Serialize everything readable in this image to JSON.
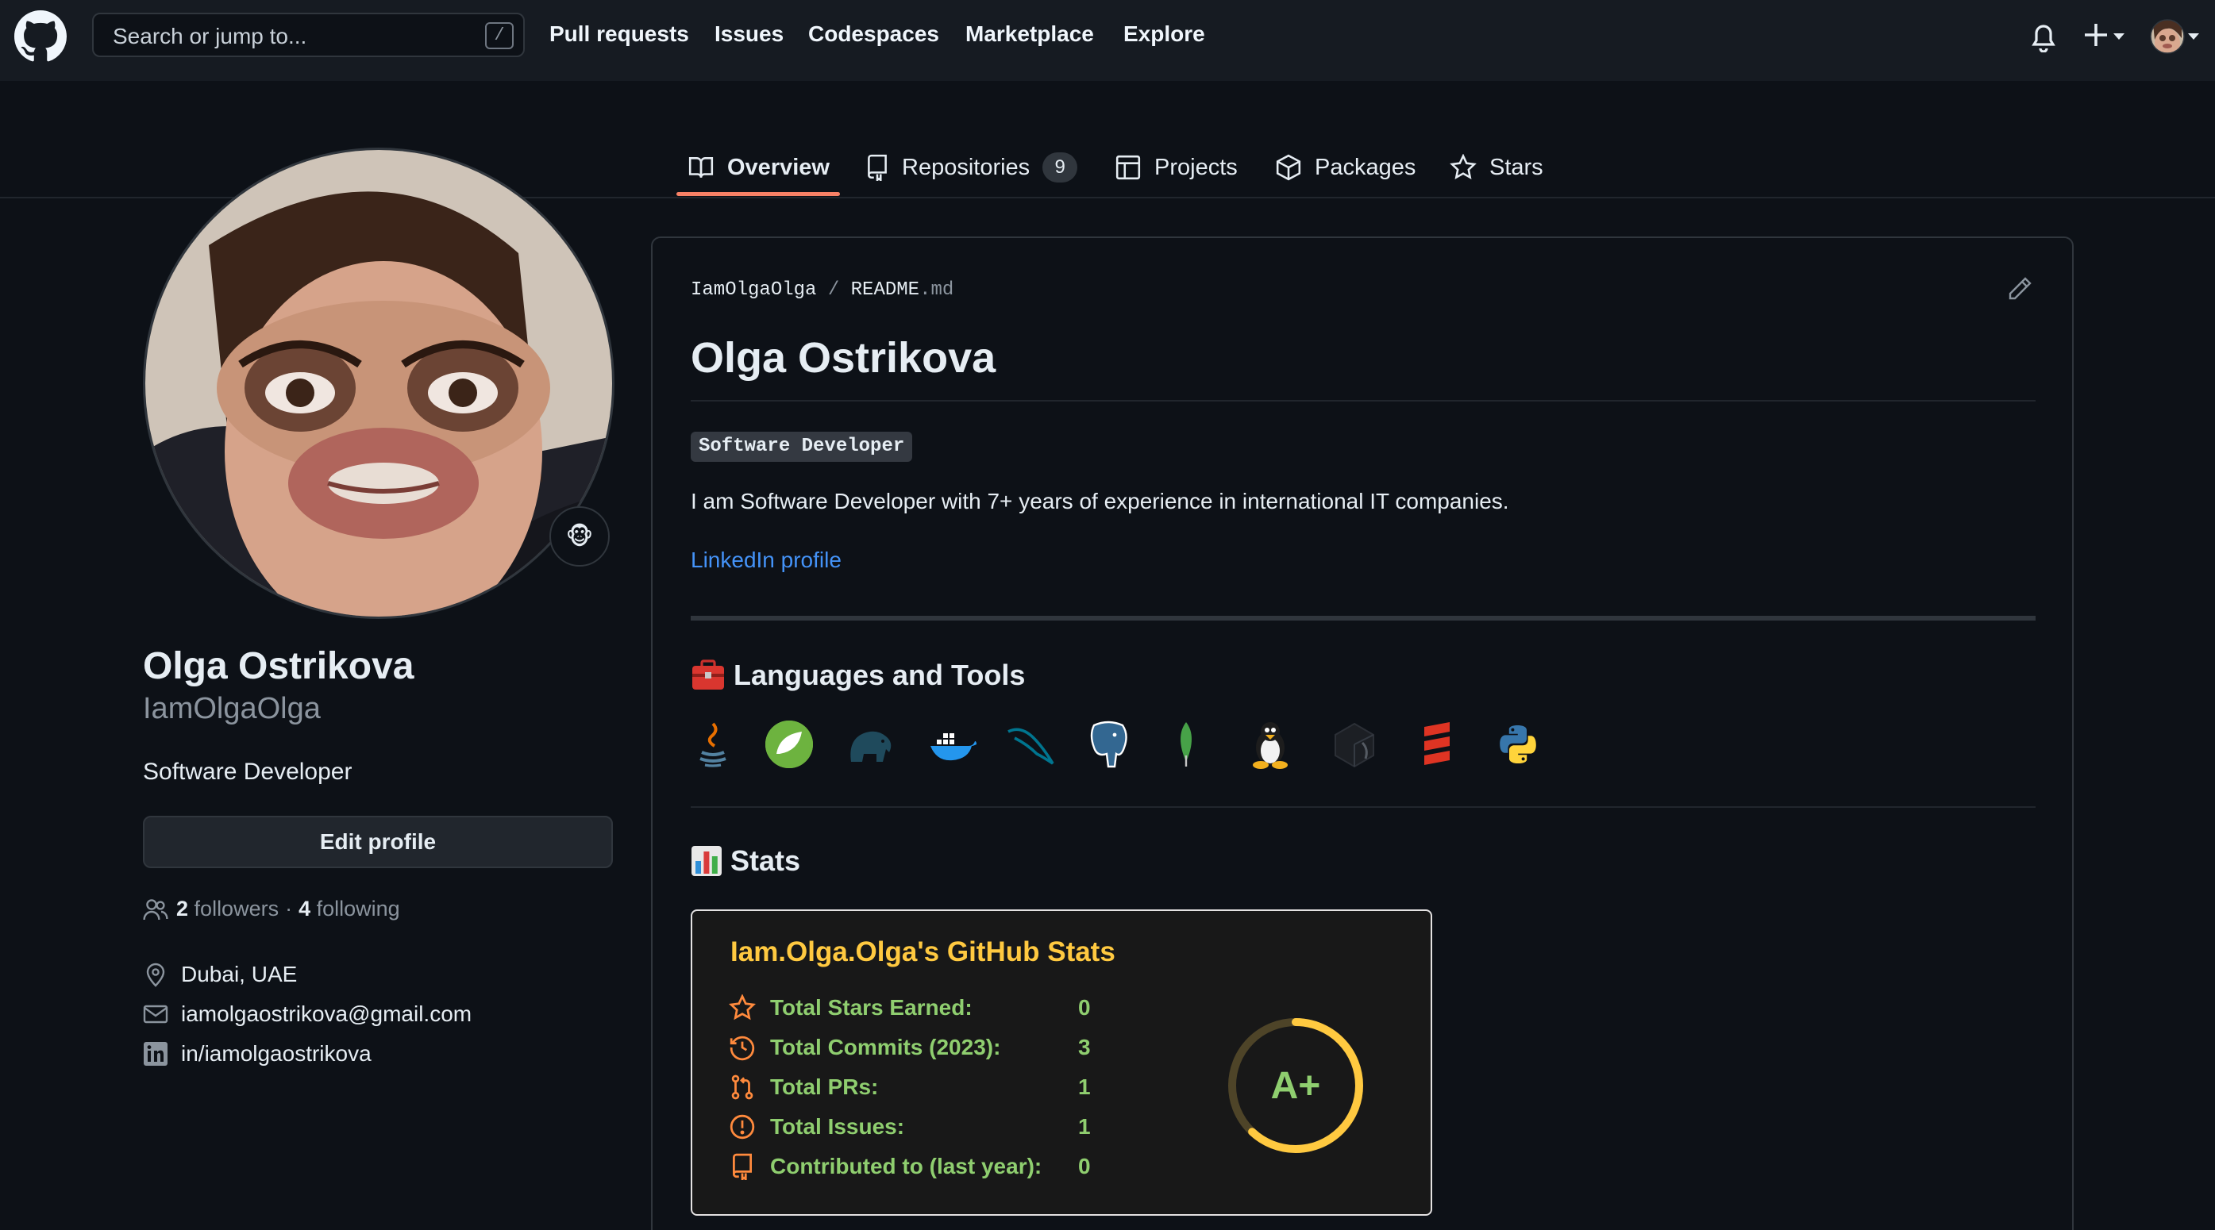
{
  "header": {
    "search_placeholder": "Search or jump to...",
    "search_shortcut": "/",
    "nav": [
      "Pull requests",
      "Issues",
      "Codespaces",
      "Marketplace",
      "Explore"
    ],
    "icons": [
      "github-logo",
      "bell-icon",
      "plus-icon",
      "avatar-menu"
    ]
  },
  "tabs": [
    {
      "label": "Overview",
      "icon": "book-icon",
      "active": true
    },
    {
      "label": "Repositories",
      "icon": "repo-icon",
      "count": "9"
    },
    {
      "label": "Projects",
      "icon": "table-icon"
    },
    {
      "label": "Packages",
      "icon": "package-icon"
    },
    {
      "label": "Stars",
      "icon": "star-icon"
    }
  ],
  "profile": {
    "name": "Olga Ostrikova",
    "login": "IamOlgaOlga",
    "bio": "Software Developer",
    "status_emoji": "🐵",
    "edit_button": "Edit profile",
    "followers_count": "2",
    "followers_label": "followers",
    "separator": "·",
    "following_count": "4",
    "following_label": "following",
    "location": "Dubai, UAE",
    "email": "iamolgaostrikova@gmail.com",
    "linkedin": "in/iamolgaostrikova"
  },
  "readme": {
    "owner": "IamOlgaOlga",
    "path_sep": "/",
    "file": "README",
    "ext": ".md",
    "title": "Olga Ostrikova",
    "badge": "Software Developer",
    "intro": "I am Software Developer with 7+ years of experience in international IT companies.",
    "link_text": "LinkedIn profile",
    "tools_heading": "Languages and Tools",
    "tools_emoji": "toolbox-icon",
    "tools": [
      "java-icon",
      "spring-icon",
      "hadoop-elephant-icon",
      "docker-icon",
      "mysql-icon",
      "postgresql-icon",
      "mongodb-icon",
      "linux-icon",
      "cube-icon",
      "scala-icon",
      "python-icon"
    ],
    "stats_heading": "Stats",
    "stats_emoji": "bar-chart-icon"
  },
  "stats": {
    "title": "Iam.Olga.Olga's GitHub Stats",
    "rows": [
      {
        "label": "Total Stars Earned:",
        "value": "0",
        "icon": "star-icon"
      },
      {
        "label": "Total Commits (2023):",
        "value": "3",
        "icon": "history-icon"
      },
      {
        "label": "Total PRs:",
        "value": "1",
        "icon": "pr-icon"
      },
      {
        "label": "Total Issues:",
        "value": "1",
        "icon": "issue-icon"
      },
      {
        "label": "Contributed to (last year):",
        "value": "0",
        "icon": "repo-icon"
      }
    ],
    "grade": "A+",
    "ring_progress": 0.62,
    "title_color": "#ffc940",
    "text_color": "#8fce6f",
    "ring_color": "#ffc940"
  }
}
